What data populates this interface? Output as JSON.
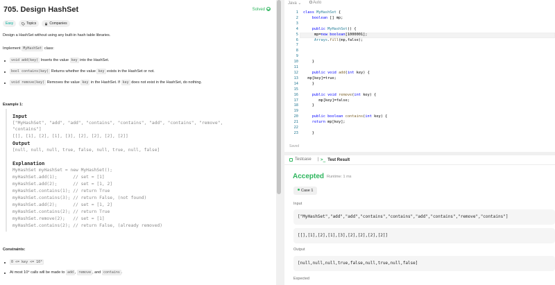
{
  "problem": {
    "title": "705. Design HashSet",
    "solved_label": "Solved",
    "tags": [
      "Easy",
      "Topics",
      "Companies"
    ],
    "description": "Design a HashSet without using any built-in hash table libraries.",
    "implement_prefix": "Implement",
    "implement_class": "MyHashSet",
    "implement_suffix": "class:",
    "methods": [
      {
        "sig": "void add(key)",
        "pre": "Inserts the value",
        "code": "key",
        "post": "into the HashSet."
      },
      {
        "sig": "bool contains(key)",
        "pre": "Returns whether the value",
        "code": "key",
        "post": "exists in the HashSet or not."
      },
      {
        "sig": "void remove(key)",
        "pre": "Removes the value",
        "code": "key",
        "post": "in the HashSet. If",
        "code2": "key",
        "post2": "does not exist in the HashSet, do nothing."
      }
    ],
    "example_title": "Example 1:",
    "input_label": "Input",
    "input_line1": "[\"MyHashSet\", \"add\", \"add\", \"contains\", \"contains\", \"add\", \"contains\", \"remove\",",
    "input_line2": "\"contains\"]",
    "input_line3": "[[], [1], [2], [1], [3], [2], [2], [2], [2]]",
    "output_label": "Output",
    "output_line": "[null, null, null, true, false, null, true, null, false]",
    "explanation_label": "Explanation",
    "explanation_lines": [
      "MyHashSet myHashSet = new MyHashSet();",
      "myHashSet.add(1);      // set = [1]",
      "myHashSet.add(2);      // set = [1, 2]",
      "myHashSet.contains(1); // return True",
      "myHashSet.contains(3); // return False, (not found)",
      "myHashSet.add(2);      // set = [1, 2]",
      "myHashSet.contains(2); // return True",
      "myHashSet.remove(2);   // set = [1]",
      "myHashSet.contains(2); // return False, (already removed)"
    ],
    "constraints_title": "Constraints:",
    "constraint1": "0 <= key <= 10⁶",
    "constraint2_pre": "At most 10⁴ calls will be made to",
    "constraint2_codes": [
      "add",
      "remove",
      "contains"
    ]
  },
  "editor": {
    "language": "Java",
    "mode": "Auto",
    "line_numbers": [
      "1",
      "2",
      "3",
      "4",
      "5",
      "6",
      "7",
      "8",
      "9",
      "10",
      "11",
      "12",
      "13",
      "14",
      "15",
      "16",
      "17",
      "18",
      "19",
      "20",
      "21",
      "22",
      "23"
    ],
    "code_lines": [
      "class MyHashSet {",
      "    boolean [] mp;",
      "",
      "    public MyHashSet() {",
      "     mp=new boolean[1000001];",
      "     Arrays.fill(mp,false);",
      "",
      "",
      "",
      "    }",
      "",
      "    public void add(int key) {",
      "  mp[key]=true;",
      "    }",
      "",
      "    public void remove(int key) {",
      "       mp[key]=false;",
      "    }",
      "",
      "    public boolean contains(int key) {",
      "    return mp[key];",
      "",
      "    }",
      "}"
    ],
    "saved_label": "Saved"
  },
  "results": {
    "tab_testcase": "Testcase",
    "tab_result": "Test Result",
    "status": "Accepted",
    "runtime": "Runtime: 1 ms",
    "case_label": "Case 1",
    "input_label": "Input",
    "input_value1": "[\"MyHashSet\",\"add\",\"add\",\"contains\",\"contains\",\"add\",\"contains\",\"remove\",\"contains\"]",
    "input_value2": "[[],[1],[2],[1],[3],[2],[2],[2],[2]]",
    "output_label": "Output",
    "output_value": "[null,null,null,true,false,null,true,null,false]",
    "expected_label": "Expected"
  },
  "colors": {
    "accent_green": "#2db55d",
    "easy": "#00af9b"
  }
}
